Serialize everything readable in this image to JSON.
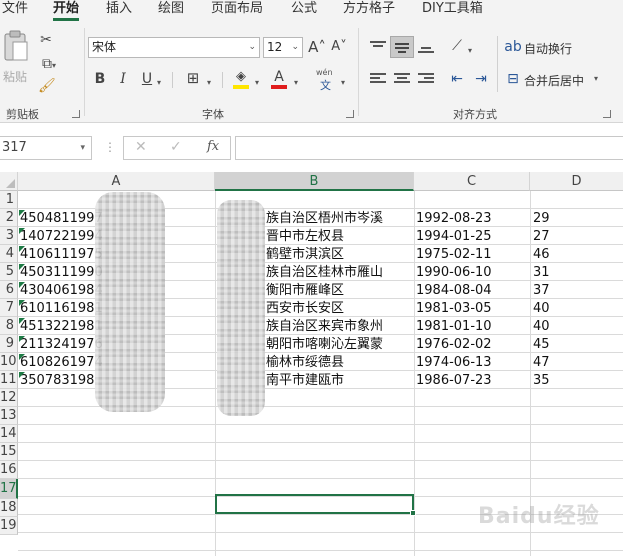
{
  "menu": {
    "tabs": [
      "文件",
      "开始",
      "插入",
      "绘图",
      "页面布局",
      "公式",
      "方方格子",
      "DIY工具箱"
    ],
    "active": "开始"
  },
  "clipboard": {
    "paste_label": "粘贴",
    "group_label": "剪贴板"
  },
  "font": {
    "name": "宋体",
    "size": "12",
    "grow_label": "A˄",
    "shrink_label": "A˅",
    "bold": "B",
    "italic": "I",
    "underline": "U",
    "font_color_glyph": "A",
    "wen_label_top": "wén",
    "wen_label_bottom": "文",
    "group_label": "字体",
    "fill_color": "#ffe600",
    "font_color": "#e01c1c"
  },
  "alignment": {
    "wrap_label": "自动换行",
    "merge_label": "合并后居中",
    "group_label": "对齐方式"
  },
  "formula_bar": {
    "name_box": "317",
    "fx": "fx",
    "value": ""
  },
  "grid": {
    "columns": [
      "A",
      "B",
      "C",
      "D"
    ],
    "row_labels": [
      "1",
      "2",
      "3",
      "4",
      "5",
      "6",
      "7",
      "8",
      "9",
      "10",
      "11",
      "12",
      "13",
      "14",
      "15",
      "16",
      "17",
      "18",
      "19"
    ],
    "selected_row": "17",
    "selected_col": "B",
    "rows": [
      {
        "a": "4504811997",
        "b": "族自治区梧州市岑溪",
        "c": "1992-08-23",
        "d": "29"
      },
      {
        "a": "1407221994",
        "b": "晋中市左权县",
        "c": "1994-01-25",
        "d": "27"
      },
      {
        "a": "4106111975",
        "b": "鹤壁市淇滨区",
        "c": "1975-02-11",
        "d": "46"
      },
      {
        "a": "4503111990",
        "b": "族自治区桂林市雁山",
        "c": "1990-06-10",
        "d": "31"
      },
      {
        "a": "4304061984",
        "b": "衡阳市雁峰区",
        "c": "1984-08-04",
        "d": "37"
      },
      {
        "a": "6101161981",
        "b": "西安市长安区",
        "c": "1981-03-05",
        "d": "40"
      },
      {
        "a": "4513221981",
        "b": "族自治区来宾市象州",
        "c": "1981-01-10",
        "d": "40"
      },
      {
        "a": "2113241976",
        "b": "朝阳市喀喇沁左翼蒙",
        "c": "1976-02-02",
        "d": "45"
      },
      {
        "a": "6108261974",
        "b": "榆林市绥德县",
        "c": "1974-06-13",
        "d": "47"
      },
      {
        "a": "350783198",
        "b": "南平市建瓯市",
        "c": "1986-07-23",
        "d": "35"
      }
    ]
  },
  "watermark": "Baidu经验",
  "accent_color": "#217346"
}
